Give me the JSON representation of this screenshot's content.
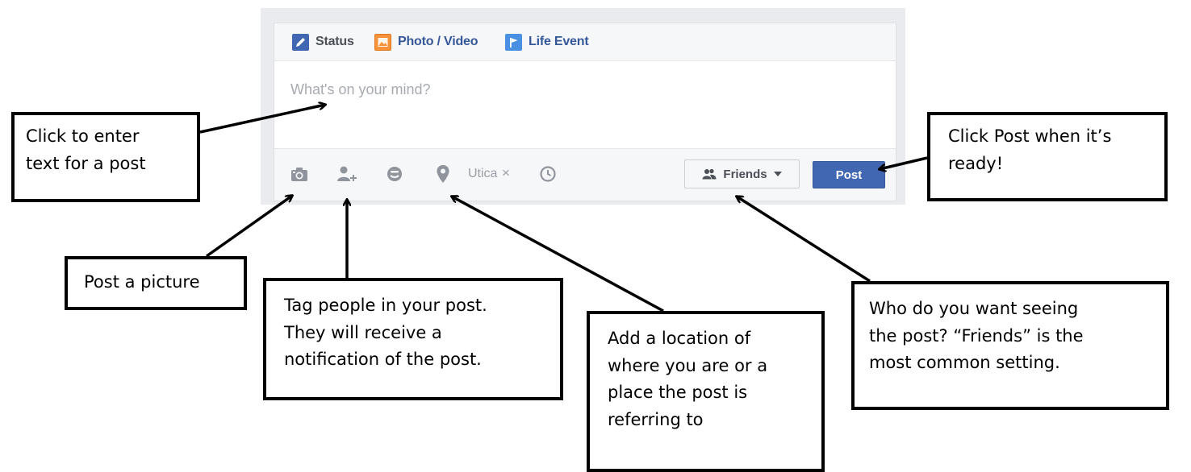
{
  "composer": {
    "tabs": [
      {
        "label": "Status",
        "icon": "pencil-icon",
        "active": true
      },
      {
        "label": "Photo / Video",
        "icon": "photo-icon",
        "active": false
      },
      {
        "label": "Life Event",
        "icon": "flag-icon",
        "active": false
      }
    ],
    "placeholder": "What's on your mind?",
    "toolbar": {
      "icons": [
        "camera-icon",
        "tag-people-icon",
        "feeling-icon",
        "location-pin-icon",
        "clock-icon"
      ],
      "location_text": "Utica",
      "location_remove": "×"
    },
    "audience_label": "Friends",
    "post_label": "Post"
  },
  "callouts": {
    "enter_text": [
      "Click to enter",
      "text for a post"
    ],
    "post_picture": [
      "Post a picture"
    ],
    "tag_people": [
      "Tag people in your post.",
      "They will receive a",
      "notification of the post."
    ],
    "location": [
      "Add a location of",
      "where you are or a",
      "place the post is",
      "referring to"
    ],
    "audience": [
      "Who do you want seeing",
      "the post? “Friends” is the",
      "most common setting."
    ],
    "post_ready": [
      "Click Post when it’s",
      "ready!"
    ]
  },
  "colors": {
    "link_blue": "#365899",
    "post_button": "#4267b2",
    "placeholder": "#a7abb1",
    "icon_gray": "#90949c",
    "panel_bg": "#e9ebee"
  }
}
